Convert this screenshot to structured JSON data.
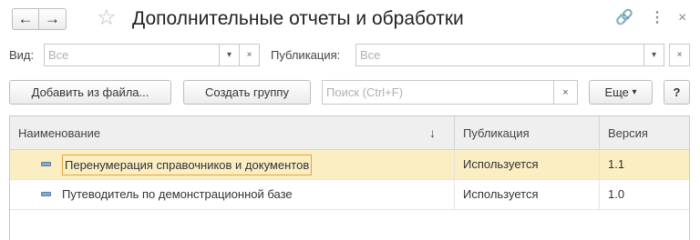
{
  "window": {
    "title": "Дополнительные отчеты и обработки",
    "back_glyph": "←",
    "forward_glyph": "→",
    "star_glyph": "☆",
    "link_glyph": "🔗",
    "more_glyph": "⋮",
    "close_glyph": "×"
  },
  "filters": {
    "kind_label": "Вид:",
    "kind_value": "Все",
    "publication_label": "Публикация:",
    "publication_value": "Все",
    "dropdown_glyph": "▾",
    "clear_glyph": "×"
  },
  "toolbar": {
    "add_from_file": "Добавить из файла...",
    "create_group": "Создать группу",
    "search_placeholder": "Поиск (Ctrl+F)",
    "search_clear": "×",
    "more": "Еще",
    "more_arrow": "▾",
    "help": "?"
  },
  "table": {
    "columns": [
      "Наименование",
      "Публикация",
      "Версия"
    ],
    "sort_glyph": "↓",
    "rows": [
      {
        "name": "Перенумерация справочников и документов",
        "publication": "Используется",
        "version": "1.1",
        "selected": true
      },
      {
        "name": "Путеводитель по демонстрационной базе",
        "publication": "Используется",
        "version": "1.0",
        "selected": false
      }
    ]
  },
  "colors": {
    "selected_row": "#fbeec3",
    "selected_border": "#e0a540",
    "header_bg": "#efefef"
  }
}
